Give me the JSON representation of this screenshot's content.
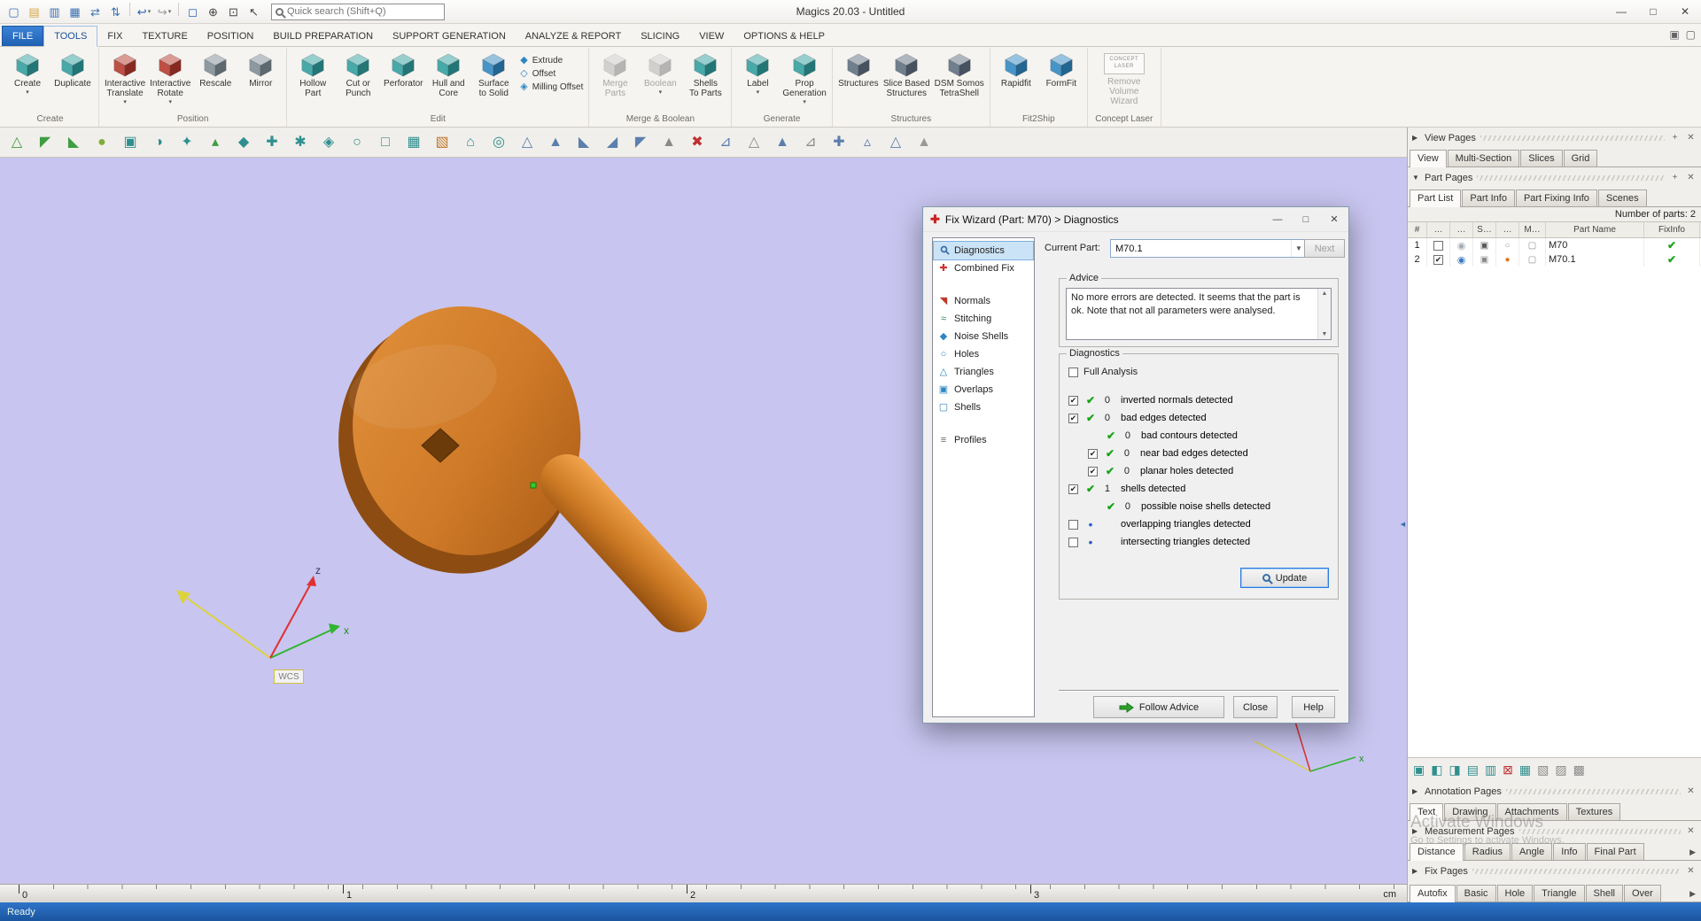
{
  "titlebar": {
    "title": "Magics 20.03 - Untitled",
    "search_placeholder": "Quick search (Shift+Q)",
    "icons": [
      {
        "name": "new-file-icon",
        "g": "▢",
        "c": "#3a6fb0"
      },
      {
        "name": "open-file-icon",
        "g": "▤",
        "c": "#d9a441"
      },
      {
        "name": "save-icon",
        "g": "▥",
        "c": "#3a6fb0"
      },
      {
        "name": "save-all-icon",
        "g": "▦",
        "c": "#3a6fb0"
      },
      {
        "name": "import-part-icon",
        "g": "⇄",
        "c": "#3a6fb0"
      },
      {
        "name": "export-part-icon",
        "g": "⇅",
        "c": "#3a6fb0",
        "sep_after": true
      },
      {
        "name": "undo-icon",
        "g": "↩",
        "c": "#2a62b8",
        "dd": true
      },
      {
        "name": "redo-icon",
        "g": "↪",
        "c": "#9a9a9a",
        "dd": true,
        "sep_after": true
      },
      {
        "name": "select-box-icon",
        "g": "◻",
        "c": "#2a62b8"
      },
      {
        "name": "zoom-in-icon",
        "g": "⊕",
        "c": "#444444"
      },
      {
        "name": "zoom-window-icon",
        "g": "⊡",
        "c": "#444444"
      },
      {
        "name": "pointer-icon",
        "g": "↖",
        "c": "#444444"
      }
    ],
    "window_controls": {
      "minimize": "—",
      "maximize": "□",
      "close": "✕"
    }
  },
  "menu": {
    "tabs": [
      {
        "label": "FILE",
        "style": "file"
      },
      {
        "label": "TOOLS",
        "active": true
      },
      {
        "label": "FIX"
      },
      {
        "label": "TEXTURE"
      },
      {
        "label": "POSITION"
      },
      {
        "label": "BUILD PREPARATION"
      },
      {
        "label": "SUPPORT GENERATION"
      },
      {
        "label": "ANALYZE & REPORT"
      },
      {
        "label": "SLICING"
      },
      {
        "label": "VIEW"
      },
      {
        "label": "OPTIONS & HELP"
      }
    ],
    "right_icons": [
      {
        "name": "selection-mode-icon",
        "g": "▣",
        "c": "#666666"
      },
      {
        "name": "marked-view-icon",
        "g": "▢",
        "c": "#666666"
      }
    ]
  },
  "ribbon": {
    "groups": [
      {
        "label": "Create",
        "buttons": [
          {
            "label": "Create",
            "lines": [
              "Create"
            ],
            "dd": true,
            "accent": "#2f9d9d"
          },
          {
            "label": "Duplicate",
            "lines": [
              "Duplicate"
            ],
            "accent": "#2f9d9d"
          }
        ]
      },
      {
        "label": "Position",
        "buttons": [
          {
            "label": "Interactive Translate",
            "lines": [
              "Interactive",
              "Translate"
            ],
            "dd": true,
            "accent": "#b4372a"
          },
          {
            "label": "Interactive Rotate",
            "lines": [
              "Interactive",
              "Rotate"
            ],
            "dd": true,
            "accent": "#b4372a"
          },
          {
            "label": "Rescale",
            "lines": [
              "Rescale"
            ],
            "accent": "#7d8b94"
          },
          {
            "label": "Mirror",
            "lines": [
              "Mirror"
            ],
            "accent": "#7d8b94"
          }
        ]
      },
      {
        "label": "Edit",
        "buttons": [
          {
            "label": "Hollow Part",
            "lines": [
              "Hollow",
              "Part"
            ],
            "accent": "#2f9d9d"
          },
          {
            "label": "Cut or Punch",
            "lines": [
              "Cut or",
              "Punch"
            ],
            "accent": "#2f9d9d"
          },
          {
            "label": "Perforator",
            "lines": [
              "Perforator"
            ],
            "accent": "#2f9d9d"
          },
          {
            "label": "Hull and Core",
            "lines": [
              "Hull and",
              "Core"
            ],
            "accent": "#2f9d9d"
          },
          {
            "label": "Surface to Solid",
            "lines": [
              "Surface",
              "to Solid"
            ],
            "accent": "#2e86c1"
          }
        ],
        "stack": [
          {
            "label": "Extrude",
            "g": "◆",
            "c": "#2e86c1"
          },
          {
            "label": "Offset",
            "g": "◇",
            "c": "#2e86c1"
          },
          {
            "label": "Milling Offset",
            "g": "◈",
            "c": "#2e86c1"
          }
        ]
      },
      {
        "label": "Merge & Boolean",
        "buttons": [
          {
            "label": "Merge Parts",
            "lines": [
              "Merge",
              "Parts"
            ],
            "disabled": true,
            "accent": "#9a9a9a"
          },
          {
            "label": "Boolean",
            "lines": [
              "Boolean"
            ],
            "dd": true,
            "disabled": true,
            "accent": "#9a9a9a"
          },
          {
            "label": "Shells To Parts",
            "lines": [
              "Shells",
              "To Parts"
            ],
            "accent": "#2f9d9d"
          }
        ]
      },
      {
        "label": "Generate",
        "buttons": [
          {
            "label": "Label",
            "lines": [
              "Label"
            ],
            "dd": true,
            "accent": "#2f9d9d"
          },
          {
            "label": "Prop Generation",
            "lines": [
              "Prop",
              "Generation"
            ],
            "dd": true,
            "accent": "#2f9d9d"
          }
        ]
      },
      {
        "label": "Structures",
        "buttons": [
          {
            "label": "Structures",
            "lines": [
              "Structures"
            ],
            "accent": "#5d6d7e"
          },
          {
            "label": "Slice Based Structures",
            "lines": [
              "Slice Based",
              "Structures"
            ],
            "accent": "#5d6d7e"
          },
          {
            "label": "DSM Somos TetraShell",
            "lines": [
              "DSM Somos",
              "TetraShell"
            ],
            "accent": "#5d6d7e"
          }
        ]
      },
      {
        "label": "Fit2Ship",
        "buttons": [
          {
            "label": "Rapidfit",
            "lines": [
              "Rapidfit"
            ],
            "accent": "#2e86c1"
          },
          {
            "label": "FormFit",
            "lines": [
              "FormFit"
            ],
            "accent": "#2e86c1"
          }
        ]
      },
      {
        "label": "Concept Laser",
        "buttons": [
          {
            "label": "Remove Volume Wizard",
            "lines": [
              "Remove Volume",
              "Wizard"
            ],
            "disabled": true,
            "logo": true,
            "logo_text": "CONCEPT LASER"
          }
        ]
      }
    ]
  },
  "toolbar2": [
    {
      "name": "mark-triangle-icon",
      "g": "△",
      "c": "#3f9d42"
    },
    {
      "name": "mark-plane-icon",
      "g": "◤",
      "c": "#3f9d42"
    },
    {
      "name": "mark-surface-icon",
      "g": "◣",
      "c": "#3f9d42"
    },
    {
      "name": "mark-shell-icon",
      "g": "●",
      "c": "#7fae3a"
    },
    {
      "name": "window-selection-icon",
      "g": "▣",
      "c": "#2f8f8f"
    },
    {
      "name": "brush-selection-icon",
      "g": "◑",
      "c": "#2f8f8f"
    },
    {
      "name": "free-mark-icon",
      "g": "✦",
      "c": "#2f8f8f"
    },
    {
      "name": "small-triangle-icon",
      "g": "▴",
      "c": "#3f9d42"
    },
    {
      "name": "diamond-select-icon",
      "g": "◆",
      "c": "#2f8f8f"
    },
    {
      "name": "cross-select-icon",
      "g": "✚",
      "c": "#2f8f8f"
    },
    {
      "name": "star-select-icon",
      "g": "✱",
      "c": "#2f8f8f"
    },
    {
      "name": "gem-select-icon",
      "g": "◈",
      "c": "#2f8f8f"
    },
    {
      "name": "circle-select-icon",
      "g": "○",
      "c": "#2f8f8f"
    },
    {
      "name": "box-select-icon",
      "g": "□",
      "c": "#2f8f8f"
    },
    {
      "name": "grid-select-icon",
      "g": "▦",
      "c": "#2f8f8f"
    },
    {
      "name": "cube-select-icon",
      "g": "▧",
      "c": "#c07a30"
    },
    {
      "name": "home-view-icon",
      "g": "⌂",
      "c": "#2f8f8f"
    },
    {
      "name": "target-view-icon",
      "g": "◎",
      "c": "#2f8f8f"
    },
    {
      "name": "fix-triangle-a-icon",
      "g": "△",
      "c": "#5b7fae"
    },
    {
      "name": "fix-triangle-b-icon",
      "g": "▲",
      "c": "#5b7fae"
    },
    {
      "name": "fix-triangle-c-icon",
      "g": "◣",
      "c": "#5b7fae"
    },
    {
      "name": "fix-triangle-d-icon",
      "g": "◢",
      "c": "#5b7fae"
    },
    {
      "name": "fix-triangle-e-icon",
      "g": "◤",
      "c": "#5b7fae"
    },
    {
      "name": "fix-triangle-f-icon",
      "g": "▲",
      "c": "#8a8a8a"
    },
    {
      "name": "delete-marked-icon",
      "g": "✖",
      "c": "#c03030"
    },
    {
      "name": "triangle-arrow-icon",
      "g": "⊿",
      "c": "#5b7fae"
    },
    {
      "name": "flip-triangle-icon",
      "g": "△",
      "c": "#8a8a8a"
    },
    {
      "name": "stitch-triangle-icon",
      "g": "▲",
      "c": "#5b7fae"
    },
    {
      "name": "hole-triangle-icon",
      "g": "⊿",
      "c": "#8a8a8a"
    },
    {
      "name": "add-triangle-icon",
      "g": "✚",
      "c": "#5b7fae"
    },
    {
      "name": "detail-triangle-icon",
      "g": "▵",
      "c": "#5b7fae"
    },
    {
      "name": "smooth-triangle-icon",
      "g": "△",
      "c": "#5b7fae"
    },
    {
      "name": "final-triangle-icon",
      "g": "▲",
      "c": "#9a9a9a"
    }
  ],
  "viewport": {
    "wcs_label": "WCS",
    "axis_x_label": "x",
    "axis_z_label": "z",
    "mini_axis_x_label": "x",
    "ruler_ticks": [
      "0",
      "1",
      "2",
      "3"
    ],
    "ruler_unit": "cm"
  },
  "dialog": {
    "title": "Fix Wizard (Part: M70) > Diagnostics",
    "controls": {
      "minimize": "—",
      "maximize": "□",
      "close": "✕"
    },
    "current_part_label": "Current Part:",
    "current_part_value": "M70.1",
    "next_label": "Next",
    "nav": [
      {
        "label": "Diagnostics",
        "icon": "mag",
        "active": true
      },
      {
        "label": "Combined Fix",
        "g": "✚",
        "c": "#cc3333"
      },
      {
        "gap": true
      },
      {
        "label": "Normals",
        "g": "◥",
        "c": "#c0392b"
      },
      {
        "label": "Stitching",
        "g": "≈",
        "c": "#2e8b57"
      },
      {
        "label": "Noise Shells",
        "g": "◆",
        "c": "#2e86c1"
      },
      {
        "label": "Holes",
        "g": "○",
        "c": "#2e86c1"
      },
      {
        "label": "Triangles",
        "g": "△",
        "c": "#2e86c1"
      },
      {
        "label": "Overlaps",
        "g": "▣",
        "c": "#2e86c1"
      },
      {
        "label": "Shells",
        "g": "▢",
        "c": "#2e86c1"
      },
      {
        "gap": true
      },
      {
        "label": "Profiles",
        "g": "≡",
        "c": "#666666"
      }
    ],
    "advice_title": "Advice",
    "advice_text": "No more errors are detected. It seems that the part is ok. Note that not all parameters were analysed.",
    "diagnostics_title": "Diagnostics",
    "full_analysis_label": "Full Analysis",
    "rows": [
      {
        "has_checkbox": true,
        "checked": true,
        "status": "check",
        "count": "0",
        "label": "inverted normals detected",
        "indent": 0
      },
      {
        "has_checkbox": true,
        "checked": true,
        "status": "check",
        "count": "0",
        "label": "bad edges detected",
        "indent": 0
      },
      {
        "has_checkbox": false,
        "checked": false,
        "status": "check",
        "count": "0",
        "label": "bad contours detected",
        "indent": 1
      },
      {
        "has_checkbox": true,
        "checked": true,
        "status": "check",
        "count": "0",
        "label": "near bad edges detected",
        "indent": 1
      },
      {
        "has_checkbox": true,
        "checked": true,
        "status": "check",
        "count": "0",
        "label": "planar holes detected",
        "indent": 1
      },
      {
        "has_checkbox": true,
        "checked": true,
        "status": "check",
        "count": "1",
        "label": "shells detected",
        "indent": 0
      },
      {
        "has_checkbox": false,
        "checked": false,
        "status": "check",
        "count": "0",
        "label": "possible noise shells detected",
        "indent": 1
      },
      {
        "has_checkbox": true,
        "checked": false,
        "status": "dot",
        "count": "",
        "label": "overlapping triangles detected",
        "indent": 0
      },
      {
        "has_checkbox": true,
        "checked": false,
        "status": "dot",
        "count": "",
        "label": "intersecting triangles detected",
        "indent": 0
      }
    ],
    "update_label": "Update",
    "follow_advice_label": "Follow Advice",
    "close_label": "Close",
    "help_label": "Help"
  },
  "right_panel": {
    "view_pages": {
      "title": "View Pages",
      "arrow": "▶",
      "tabs": [
        "View",
        "Multi-Section",
        "Slices",
        "Grid"
      ],
      "active": "View",
      "icons": [
        {
          "name": "add-page-icon",
          "g": "+"
        },
        {
          "name": "close-pages-icon",
          "g": "✕"
        }
      ]
    },
    "part_pages": {
      "title": "Part Pages",
      "arrow": "▼",
      "tabs": [
        "Part List",
        "Part Info",
        "Part Fixing Info",
        "Scenes"
      ],
      "active": "Part List",
      "count_label": "Number of parts: 2",
      "icons": [
        {
          "name": "add-page-icon",
          "g": "+"
        },
        {
          "name": "close-pages-icon",
          "g": "✕"
        }
      ]
    },
    "part_table": {
      "headers": [
        "#",
        "…",
        "…",
        "S…",
        "…",
        "M…",
        "Part Name",
        "FixInfo"
      ],
      "rows": [
        {
          "num": "1",
          "checked": false,
          "eye_color": "#a4adb5",
          "icons": [
            {
              "g": "▣",
              "c": "#5a5a5a"
            },
            {
              "g": "○",
              "c": "#9a9a9a"
            },
            {
              "g": "▢",
              "c": "#8a8a8a"
            }
          ],
          "name": "M70"
        },
        {
          "num": "2",
          "checked": true,
          "eye_color": "#3a7abf",
          "icons": [
            {
              "g": "▣",
              "c": "#8a8a8a"
            },
            {
              "g": "●",
              "c": "#e07820"
            },
            {
              "g": "▢",
              "c": "#8a8a8a"
            }
          ],
          "name": "M70.1"
        }
      ]
    },
    "tool_icons": [
      {
        "name": "view-part-icon",
        "g": "▣",
        "c": "#2f8f8f"
      },
      {
        "name": "zoom-part-icon",
        "g": "◧",
        "c": "#2f8f8f"
      },
      {
        "name": "translate-part-icon",
        "g": "◨",
        "c": "#2f8f8f"
      },
      {
        "name": "duplicate-part-icon",
        "g": "▤",
        "c": "#2f8f8f"
      },
      {
        "name": "merge-part-icon",
        "g": "▥",
        "c": "#2f8f8f"
      },
      {
        "name": "delete-part-icon",
        "g": "⊠",
        "c": "#c03030"
      },
      {
        "name": "part-info-icon",
        "g": "▦",
        "c": "#2f8f8f"
      },
      {
        "name": "lock-part-icon",
        "g": "▧",
        "c": "#8a8a8a"
      },
      {
        "name": "hide-part-icon",
        "g": "▨",
        "c": "#8a8a8a"
      },
      {
        "name": "export-list-icon",
        "g": "▩",
        "c": "#8a8a8a"
      }
    ],
    "annotation_pages": {
      "title": "Annotation Pages",
      "arrow": "▶",
      "tabs": [
        "Text",
        "Drawing",
        "Attachments",
        "Textures"
      ],
      "active": "Text",
      "icons": [
        {
          "name": "close-pages-icon",
          "g": "✕"
        }
      ]
    },
    "measurement_pages": {
      "title": "Measurement Pages",
      "arrow": "▶",
      "tabs": [
        "Distance",
        "Radius",
        "Angle",
        "Info",
        "Final Part"
      ],
      "active": "Distance",
      "scroll": true,
      "icons": [
        {
          "name": "close-pages-icon",
          "g": "✕"
        }
      ]
    },
    "fix_pages": {
      "title": "Fix Pages",
      "arrow": "▶",
      "tabs": [
        "Autofix",
        "Basic",
        "Hole",
        "Triangle",
        "Shell",
        "Over"
      ],
      "active": "Autofix",
      "scroll": true,
      "icons": [
        {
          "name": "close-pages-icon",
          "g": "✕"
        }
      ]
    }
  },
  "statusbar": {
    "text": "Ready"
  },
  "watermark": {
    "line1": "Activate Windows",
    "line2": "Go to Settings to activate Windows."
  }
}
